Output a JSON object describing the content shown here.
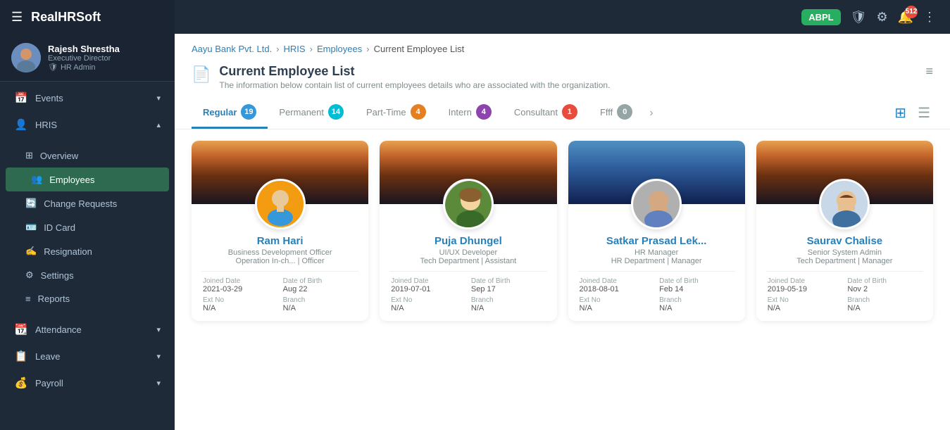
{
  "app": {
    "title": "RealHRSoft",
    "hamburger": "☰",
    "badge": "ABPL"
  },
  "user": {
    "name": "Rajesh Shrestha",
    "title": "Executive Director",
    "role": "HR Admin"
  },
  "topbar": {
    "badge_label": "ABPL",
    "notif_count": "512"
  },
  "sidebar": {
    "sections": [
      {
        "label": "Events",
        "icon": "📅",
        "has_chevron": true
      },
      {
        "label": "HRIS",
        "icon": "👤",
        "has_chevron": true,
        "expanded": true
      }
    ],
    "hris_items": [
      {
        "label": "Overview",
        "icon": "⊞",
        "active": false
      },
      {
        "label": "Employees",
        "icon": "👥",
        "active": true
      },
      {
        "label": "Change Requests",
        "icon": "🔄",
        "active": false
      },
      {
        "label": "ID Card",
        "icon": "🪪",
        "active": false
      },
      {
        "label": "Resignation",
        "icon": "✍",
        "active": false
      },
      {
        "label": "Settings",
        "icon": "⚙",
        "active": false
      },
      {
        "label": "Reports",
        "icon": "≡",
        "active": false
      }
    ],
    "other_sections": [
      {
        "label": "Attendance",
        "icon": "📆",
        "has_chevron": true
      },
      {
        "label": "Leave",
        "icon": "📋",
        "has_chevron": true
      },
      {
        "label": "Payroll",
        "icon": "💰",
        "has_chevron": true
      }
    ]
  },
  "breadcrumb": {
    "items": [
      "Aayu Bank Pvt. Ltd.",
      "HRIS",
      "Employees",
      "Current Employee List"
    ]
  },
  "page": {
    "title": "Current Employee List",
    "subtitle": "The information below contain list of current employees details who are associated with the organization.",
    "icon": "📄"
  },
  "tabs": [
    {
      "label": "Regular",
      "count": "19",
      "badge_class": "badge-blue",
      "active": true
    },
    {
      "label": "Permanent",
      "count": "14",
      "badge_class": "badge-cyan",
      "active": false
    },
    {
      "label": "Part-Time",
      "count": "4",
      "badge_class": "badge-orange",
      "active": false
    },
    {
      "label": "Intern",
      "count": "4",
      "badge_class": "badge-purple",
      "active": false
    },
    {
      "label": "Consultant",
      "count": "1",
      "badge_class": "badge-red",
      "active": false
    },
    {
      "label": "Ffff",
      "count": "0",
      "badge_class": "badge-gray",
      "active": false
    }
  ],
  "employees": [
    {
      "name": "Ram Hari",
      "role": "Business Development Officer",
      "dept_line": "Operation In-ch... | Officer",
      "joined_date": "2021-03-29",
      "dob": "Aug 22",
      "ext_no": "N/A",
      "branch": "N/A",
      "has_photo": false,
      "banner_color": "sunset"
    },
    {
      "name": "Puja Dhungel",
      "role": "UI/UX Developer",
      "dept_line": "Tech Department | Assistant",
      "joined_date": "2019-07-01",
      "dob": "Sep 17",
      "ext_no": "N/A",
      "branch": "N/A",
      "has_photo": true,
      "photo_desc": "woman with light hair",
      "banner_color": "sunset"
    },
    {
      "name": "Satkar Prasad Lek...",
      "role": "HR Manager",
      "dept_line": "HR Department | Manager",
      "joined_date": "2018-08-01",
      "dob": "Feb 14",
      "ext_no": "N/A",
      "branch": "N/A",
      "has_photo": true,
      "photo_desc": "man in shirt",
      "banner_color": "sunset"
    },
    {
      "name": "Saurav Chalise",
      "role": "Senior System Admin",
      "dept_line": "Tech Department | Manager",
      "joined_date": "2019-05-19",
      "dob": "Nov 2",
      "ext_no": "N/A",
      "branch": "N/A",
      "has_photo": true,
      "photo_desc": "young smiling man",
      "banner_color": "sunset"
    }
  ],
  "labels": {
    "joined_date": "Joined Date",
    "dob": "Date of Birth",
    "ext_no": "Ext No",
    "branch": "Branch"
  }
}
